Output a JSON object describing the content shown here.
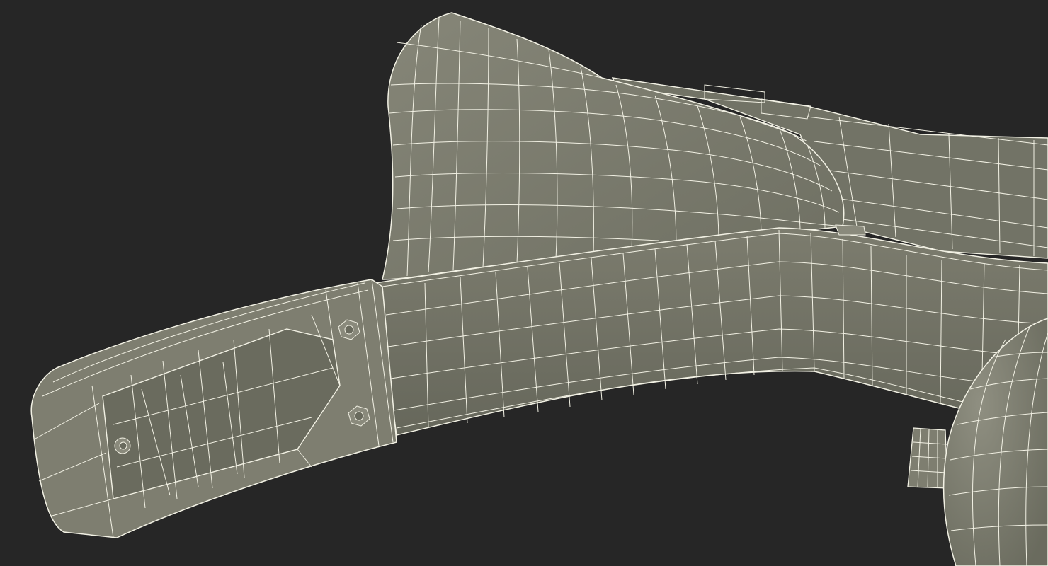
{
  "viewport": {
    "background": "#262626"
  },
  "model": {
    "surface_color": "#7a7a6c",
    "surface_dark": "#5e5f54",
    "surface_light": "#8a8a7c",
    "wire_color": "#f2f1e4",
    "parts": [
      "strap-upper-cup",
      "strap-belt",
      "strap-buckle",
      "buckle-screw",
      "side-clip",
      "bulb-sphere",
      "bulb-cap"
    ]
  }
}
